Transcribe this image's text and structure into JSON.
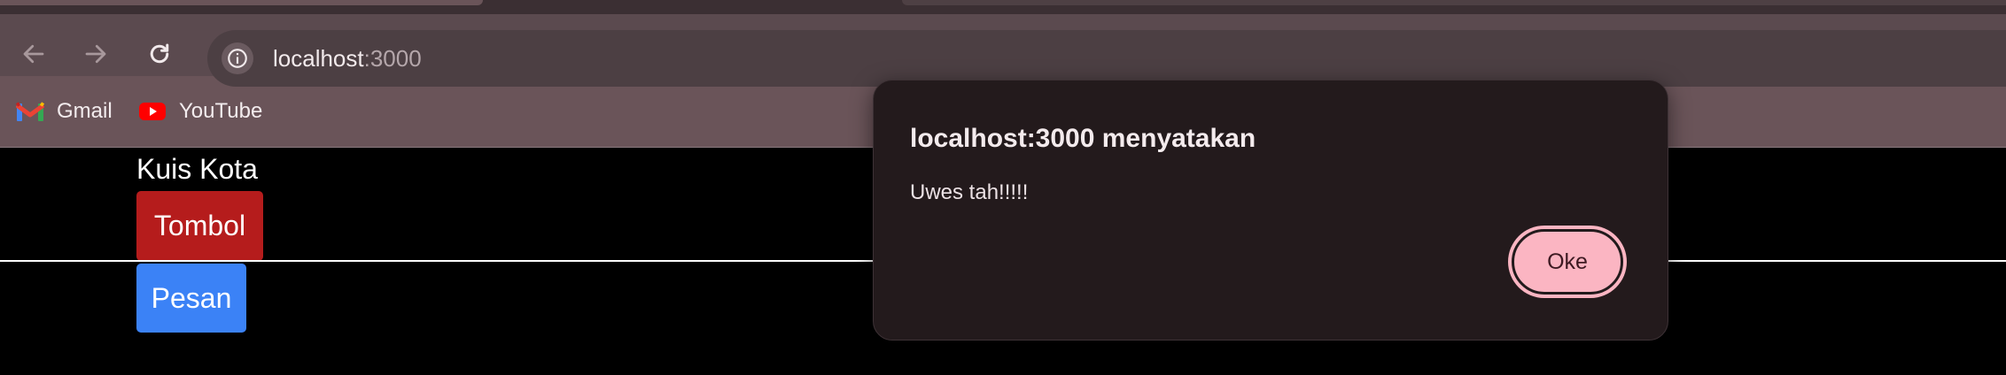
{
  "browser": {
    "url_host": "localhost",
    "url_port": ":3000",
    "bookmarks": [
      {
        "label": "Gmail",
        "icon": "gmail-icon"
      },
      {
        "label": "YouTube",
        "icon": "youtube-icon"
      }
    ],
    "icons": {
      "back": "arrow-left-icon",
      "forward": "arrow-right-icon",
      "reload": "reload-icon",
      "site_info": "info-icon"
    }
  },
  "page": {
    "title": "Kuis Kota",
    "tombol_label": "Tombol",
    "pesan_label": "Pesan"
  },
  "dialog": {
    "title": "localhost:3000 menyatakan",
    "message": "Uwes tah!!!!!",
    "ok_label": "Oke"
  },
  "colors": {
    "chrome": "#6a5459",
    "tombol": "#b51c1c",
    "pesan": "#3b82f6",
    "dialog_bg": "#231a1c",
    "ok_button": "#fbb5c2"
  }
}
